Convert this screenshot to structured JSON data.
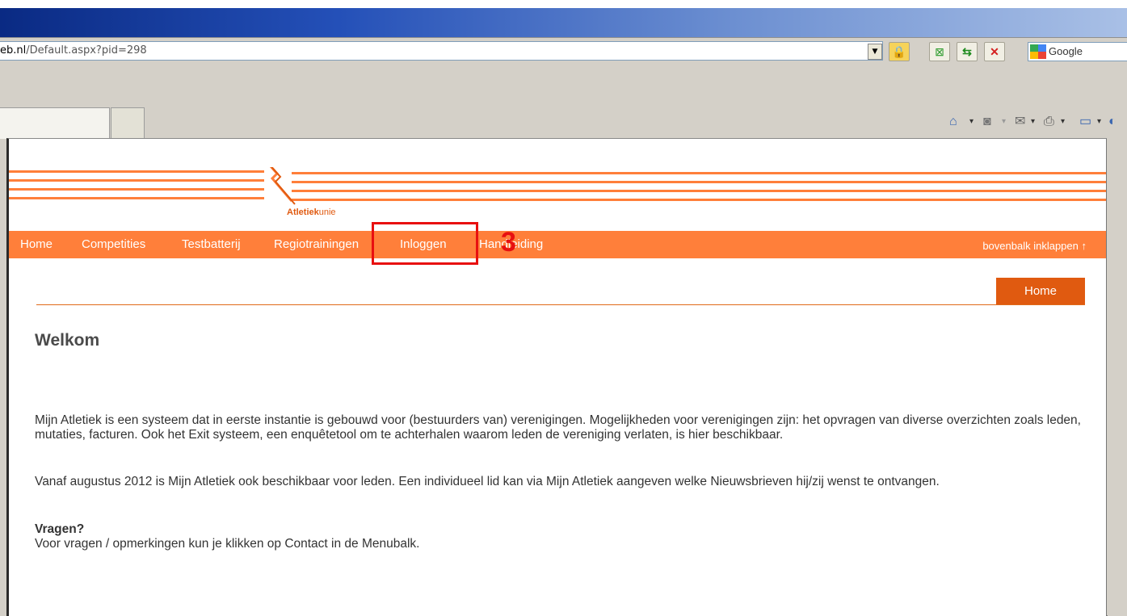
{
  "browser": {
    "address": {
      "host": "eb.nl",
      "path": "/Default.aspx?pid=298"
    },
    "search_placeholder": "Google",
    "command_bar": {
      "home_icon": "home-icon",
      "feeds_icon": "feeds-icon",
      "mail_icon": "mail-icon",
      "print_icon": "print-icon"
    }
  },
  "site": {
    "logo": "Atletiekunie",
    "logo_bold": "Atletiek",
    "logo_light": "unie",
    "nav": [
      {
        "label": "Home"
      },
      {
        "label": "Competities"
      },
      {
        "label": "Testbatterij"
      },
      {
        "label": "Regiotrainingen"
      },
      {
        "label": "Inloggen"
      },
      {
        "label": "Handleiding"
      }
    ],
    "collapse_label": "bovenbalk inklappen",
    "collapse_arrow": "↑",
    "breadcrumb_home": "Home"
  },
  "content": {
    "title": "Welkom",
    "paragraph1": "Mijn Atletiek is een systeem dat in eerste instantie is gebouwd voor (bestuurders van) verenigingen. Mogelijkheden voor verenigingen zijn: het opvragen van diverse overzichten zoals leden, mutaties, facturen. Ook het Exit systeem, een enquêtetool om te achterhalen waarom leden de vereniging verlaten, is hier beschikbaar.",
    "paragraph2": "Vanaf augustus 2012 is Mijn Atletiek ook beschikbaar voor leden. Een individueel lid kan via Mijn Atletiek aangeven welke Nieuwsbrieven hij/zij wenst te ontvangen.",
    "questions_heading": "Vragen?",
    "questions_text": "Voor vragen / opmerkingen kun je klikken op Contact in de Menubalk."
  },
  "annotation": {
    "step": "3",
    "color": "#e81010"
  },
  "colors": {
    "brand_orange": "#ff7f3a",
    "brand_dark_orange": "#e05a10"
  }
}
